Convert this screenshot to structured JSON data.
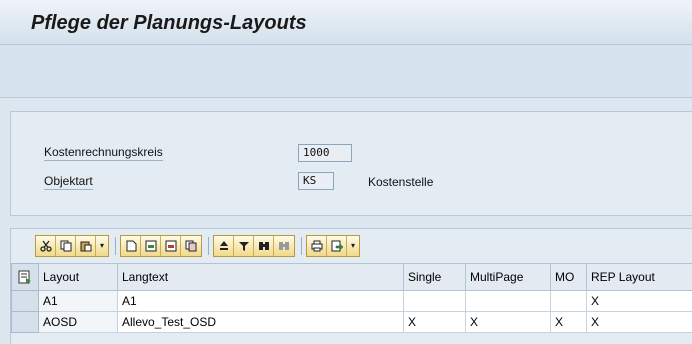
{
  "window": {
    "title": "Pflege der Planungs-Layouts"
  },
  "form": {
    "fields": [
      {
        "label": "Kostenrechnungskreis",
        "value": "1000",
        "description": ""
      },
      {
        "label": "Objektart",
        "value": "KS",
        "description": "Kostenstelle"
      }
    ]
  },
  "toolbar": {
    "icons": [
      "cut-icon",
      "copy-icon",
      "paste-icon",
      "dropdown-arrow",
      "new-row-icon",
      "insert-row-icon",
      "delete-row-icon",
      "copy-row-icon",
      "sort-ascending-icon",
      "filter-icon",
      "find-icon",
      "find-next-icon",
      "print-icon",
      "export-icon",
      "dropdown-arrow"
    ]
  },
  "table": {
    "columns": [
      "Layout",
      "Langtext",
      "Single",
      "MultiPage",
      "MO",
      "REP Layout"
    ],
    "rows": [
      [
        "A1",
        "A1",
        "",
        "",
        "",
        "X"
      ],
      [
        "AOSD",
        "Allevo_Test_OSD",
        "X",
        "X",
        "X",
        "X"
      ]
    ]
  }
}
